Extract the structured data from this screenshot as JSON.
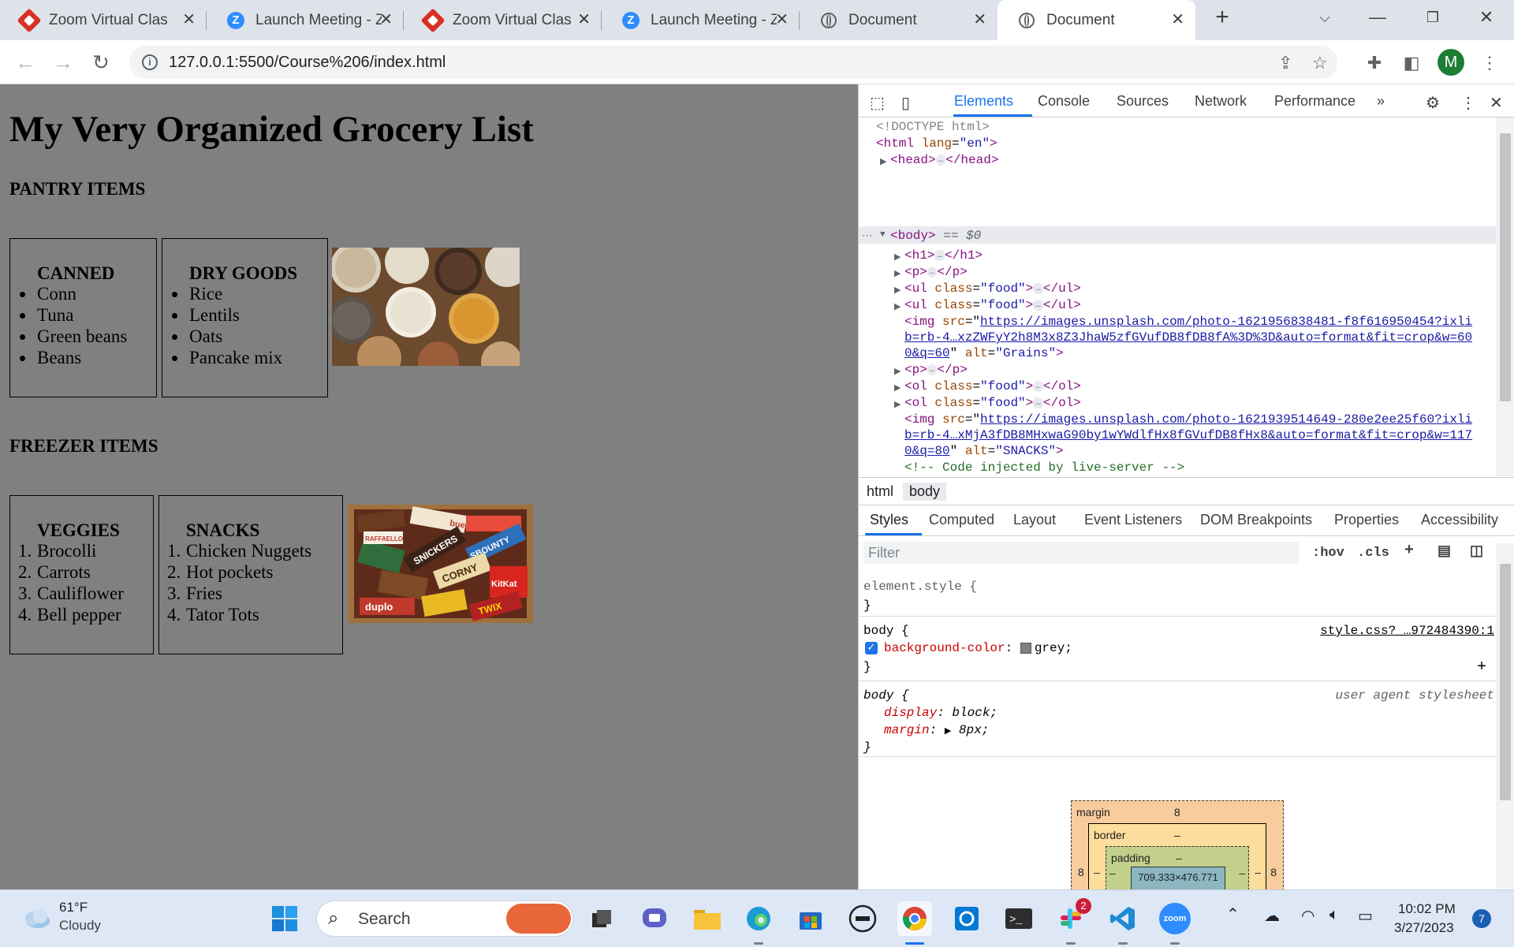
{
  "browser": {
    "tabs": [
      {
        "label": "Zoom Virtual Classroom",
        "icon": "zoom-virtual-classroom-icon"
      },
      {
        "label": "Launch Meeting - Zoom",
        "icon": "zoom-icon"
      },
      {
        "label": "Zoom Virtual Classroom",
        "icon": "zoom-virtual-classroom-icon"
      },
      {
        "label": "Launch Meeting - Zoom",
        "icon": "zoom-icon"
      },
      {
        "label": "Document",
        "icon": "globe-icon"
      },
      {
        "label": "Document",
        "icon": "globe-icon"
      }
    ],
    "active_tab_index": 5,
    "url": "127.0.0.1:5500/Course%206/index.html",
    "profile_initial": "M"
  },
  "page": {
    "heading": "My Very Organized Grocery List",
    "pantry_heading": "PANTRY ITEMS",
    "canned": {
      "title": "CANNED",
      "items": [
        "Conn",
        "Tuna",
        "Green beans",
        "Beans"
      ]
    },
    "dry_goods": {
      "title": "DRY GOODS",
      "items": [
        "Rice",
        "Lentils",
        "Oats",
        "Pancake mix"
      ]
    },
    "freezer_heading": "FREEZER ITEMS",
    "veggies": {
      "title": "VEGGIES",
      "items": [
        "Brocolli",
        "Carrots",
        "Cauliflower",
        "Bell pepper"
      ]
    },
    "snacks": {
      "title": "SNACKS",
      "items": [
        "Chicken Nuggets",
        "Hot pockets",
        "Fries",
        "Tator Tots"
      ]
    },
    "snack_brands": [
      "bueno",
      "SNICKERS",
      "SBOUNTY",
      "CORNY",
      "KitKat",
      "duplo",
      "TWIX",
      "RAFFAELLO"
    ],
    "item_numbers": [
      "1.",
      "2.",
      "3.",
      "4."
    ]
  },
  "devtools": {
    "tabs": [
      "Elements",
      "Console",
      "Sources",
      "Network",
      "Performance"
    ],
    "more_tabs": "»",
    "dom": {
      "doctype": "<!DOCTYPE html>",
      "html_open": "<html",
      "lang_attr": "lang",
      "lang_val": "\"en\"",
      "head": "<head>",
      "head_close": "</head>",
      "body": "<body>",
      "body_eq": "== $0",
      "h1": "<h1>",
      "h1_close": "</h1>",
      "p": "<p>",
      "p_close": "</p>",
      "ul": "<ul",
      "ol": "<ol",
      "class_attr": "class",
      "class_val": "\"food\"",
      "ul_close": "</ul>",
      "ol_close": "</ol>",
      "img": "<img",
      "src_attr": "src",
      "alt_attr": "alt",
      "img1_src_1": "https://images.unsplash.com/photo-1621956838481-f8f616950454?ixli",
      "img1_src_2": "b=rb-4…xzZWFyY2h8M3x8Z3JhaW5zfGVufDB8fDB8fA%3D%3D&auto=format&fit=crop&w=60",
      "img1_src_3": "0&q=60",
      "img1_alt": "\"Grains\"",
      "img2_src_1": "https://images.unsplash.com/photo-1621939514649-280e2ee25f60?ixli",
      "img2_src_2": "b=rb-4…xMjA3fDB8MHxwaG90by1wYWdlfHx8fGVufDB8fHx8&auto=format&fit=crop&w=117",
      "img2_src_3": "0&q=80",
      "img2_alt": "\"SNACKS\"",
      "comment": "<!-- Code injected by live-server -->",
      "ellipsis": "…"
    },
    "breadcrumbs": [
      "html",
      "body"
    ],
    "subtabs": [
      "Styles",
      "Computed",
      "Layout",
      "Event Listeners",
      "DOM Breakpoints",
      "Properties",
      "Accessibility"
    ],
    "filter_placeholder": "Filter",
    "hov": ":hov",
    "cls": ".cls",
    "styles": {
      "element_style": "element.style {",
      "close": "}",
      "body_sel": "body {",
      "body_source": "style.css?_…972484390:1",
      "bg_prop": "background-color",
      "bg_val": "grey;",
      "ua_source": "user agent stylesheet",
      "display_prop": "display",
      "display_val": "block;",
      "margin_prop": "margin",
      "margin_val": "8px;"
    },
    "box_model": {
      "margin_label": "margin",
      "margin_val": "8",
      "border_label": "border",
      "border_val": "–",
      "padding_label": "padding",
      "padding_val": "–",
      "content_size": "709.333×476.771",
      "side_val": "8",
      "dash": "–"
    }
  },
  "taskbar": {
    "weather_temp": "61°F",
    "weather_desc": "Cloudy",
    "search_label": "Search",
    "time": "10:02 PM",
    "date": "3/27/2023",
    "notification_count": "7",
    "slack_badge": "2",
    "zoom_label": "zoom"
  }
}
